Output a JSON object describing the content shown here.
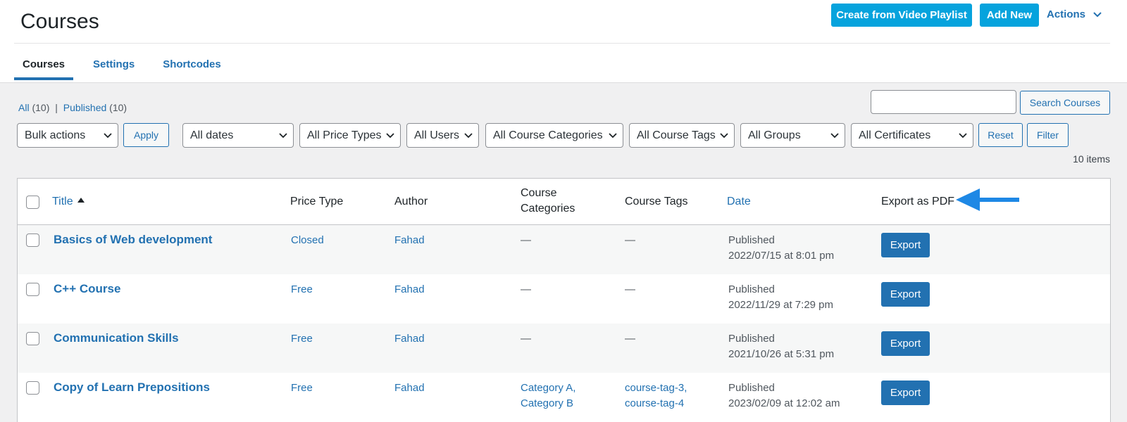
{
  "header": {
    "title": "Courses",
    "playlist_btn": "Create from Video Playlist",
    "add_new_btn": "Add New",
    "actions": "Actions"
  },
  "tabs": [
    "Courses",
    "Settings",
    "Shortcodes"
  ],
  "views": {
    "all_label": "All",
    "all_count": "(10)",
    "separator": "|",
    "published_label": "Published",
    "published_count": "(10)"
  },
  "search": {
    "value": "",
    "button": "Search Courses"
  },
  "filters": {
    "bulk": "Bulk actions",
    "apply": "Apply",
    "dates": "All dates",
    "price_types": "All Price Types",
    "users": "All Users",
    "categories": "All Course Categories",
    "tags": "All Course Tags",
    "groups": "All Groups",
    "certificates": "All Certificates",
    "reset": "Reset",
    "filter": "Filter"
  },
  "items_count": "10 items",
  "columns": {
    "title": "Title",
    "price_type": "Price Type",
    "author": "Author",
    "categories_1": "Course",
    "categories_2": "Categories",
    "tags": "Course Tags",
    "date": "Date",
    "export": "Export as PDF"
  },
  "rows": [
    {
      "title": "Basics of Web development",
      "price": "Closed",
      "author": "Fahad",
      "cat1": "—",
      "cat2": "",
      "tag1": "—",
      "tag2": "",
      "status": "Published",
      "date": "2022/07/15 at 8:01 pm",
      "export": "Export"
    },
    {
      "title": "C++ Course",
      "price": "Free",
      "author": "Fahad",
      "cat1": "—",
      "cat2": "",
      "tag1": "—",
      "tag2": "",
      "status": "Published",
      "date": "2022/11/29 at 7:29 pm",
      "export": "Export"
    },
    {
      "title": "Communication Skills",
      "price": "Free",
      "author": "Fahad",
      "cat1": "—",
      "cat2": "",
      "tag1": "—",
      "tag2": "",
      "status": "Published",
      "date": "2021/10/26 at 5:31 pm",
      "export": "Export"
    },
    {
      "title": "Copy of Learn Prepositions",
      "price": "Free",
      "author": "Fahad",
      "cat1": "Category A,",
      "cat2": "Category B",
      "tag1": "course-tag-3,",
      "tag2": "course-tag-4",
      "status": "Published",
      "date": "2023/02/09 at 12:02 am",
      "export": "Export"
    }
  ],
  "colors": {
    "primary": "#2271b1",
    "accent": "#06a3dd",
    "arrow": "#1e88e5"
  }
}
